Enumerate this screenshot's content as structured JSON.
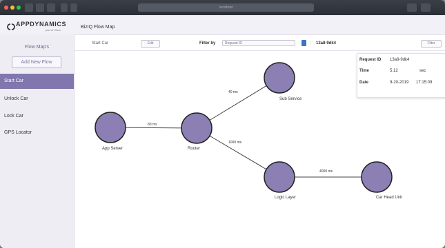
{
  "window": {
    "url_text": "localhost"
  },
  "header": {
    "logo_text": "APPDYNAMICS",
    "logo_sub": "part of Cisco",
    "app_title": "BizIQ Flow Map"
  },
  "sidebar": {
    "heading": "Flow Map's",
    "add_button": "Add New Flow",
    "items": [
      {
        "label": "Start Car",
        "active": true
      },
      {
        "label": "Unlock Car",
        "active": false
      },
      {
        "label": "Lock Car",
        "active": false
      },
      {
        "label": "GPS Locator",
        "active": false
      }
    ]
  },
  "toolbar": {
    "flow_name": "Start Car",
    "edit_label": "Edit",
    "filter_by_label": "Filter by",
    "filter_select": "Request ID",
    "filter_value": "13a8-9dk4",
    "filter_button": "Filter"
  },
  "info": {
    "request_label": "Request ID",
    "request_value": "13a8-9dk4",
    "time_label": "Time",
    "time_value": "5.12",
    "time_unit": "sec",
    "date_label": "Date",
    "date_value": "9-20-2019",
    "date_time": "17:15:09"
  },
  "flow": {
    "node_color": "#8b7fb4",
    "nodes": [
      {
        "id": "app-server",
        "label": "App Server"
      },
      {
        "id": "router",
        "label": "Router"
      },
      {
        "id": "sub-service",
        "label": "Sub Service"
      },
      {
        "id": "logic-layer",
        "label": "Logic Layer"
      },
      {
        "id": "car-head-unit",
        "label": "Car Head Unit"
      }
    ],
    "edges": [
      {
        "from": "app-server",
        "to": "router",
        "label": "80 ms"
      },
      {
        "from": "router",
        "to": "sub-service",
        "label": "40 ms"
      },
      {
        "from": "router",
        "to": "logic-layer",
        "label": "1000 ms"
      },
      {
        "from": "logic-layer",
        "to": "car-head-unit",
        "label": "4000 ms"
      }
    ]
  }
}
